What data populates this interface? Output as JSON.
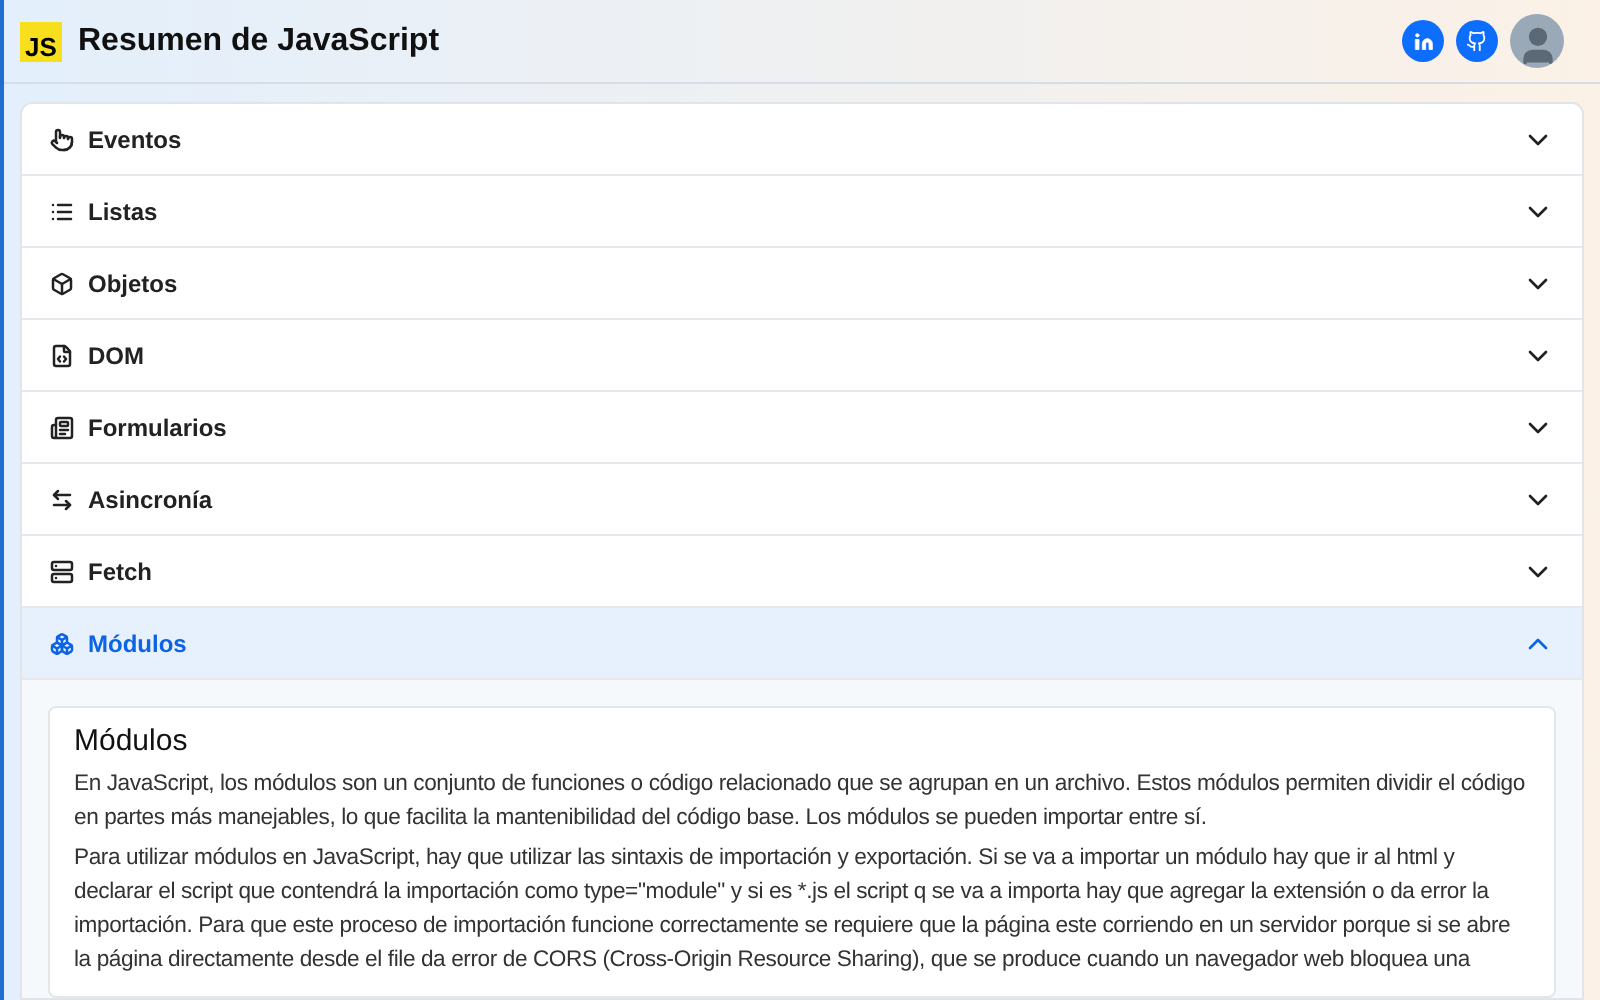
{
  "header": {
    "logo": "JS",
    "title": "Resumen de JavaScript"
  },
  "sections": [
    {
      "kind": "pointer",
      "label": "Eventos",
      "expanded": false
    },
    {
      "kind": "list",
      "label": "Listas",
      "expanded": false
    },
    {
      "kind": "box",
      "label": "Objetos",
      "expanded": false
    },
    {
      "kind": "file",
      "label": "DOM",
      "expanded": false
    },
    {
      "kind": "form",
      "label": "Formularios",
      "expanded": false
    },
    {
      "kind": "arrows",
      "label": "Asincronía",
      "expanded": false
    },
    {
      "kind": "server",
      "label": "Fetch",
      "expanded": false
    },
    {
      "kind": "cubes",
      "label": "Módulos",
      "expanded": true,
      "content": {
        "heading": "Módulos",
        "paragraphs": [
          "En JavaScript, los módulos son un conjunto de funciones o código relacionado que se agrupan en un archivo. Estos módulos permiten dividir el código en partes más manejables, lo que facilita la mantenibilidad del código base. Los módulos se pueden importar entre sí.",
          "Para utilizar módulos en JavaScript, hay que utilizar las sintaxis de importación y exportación. Si se va a importar un módulo hay que ir al html y declarar el script que contendrá la importación como type=\"module\" y si es *.js el script q se va a importa hay que agregar la extensión o da error la importación. Para que este proceso de importación funcione correctamente se requiere que la página este corriendo en un servidor porque si se abre la página directamente desde el file da error de CORS (Cross-Origin Resource Sharing), que se produce cuando un navegador web bloquea una"
        ]
      }
    }
  ]
}
